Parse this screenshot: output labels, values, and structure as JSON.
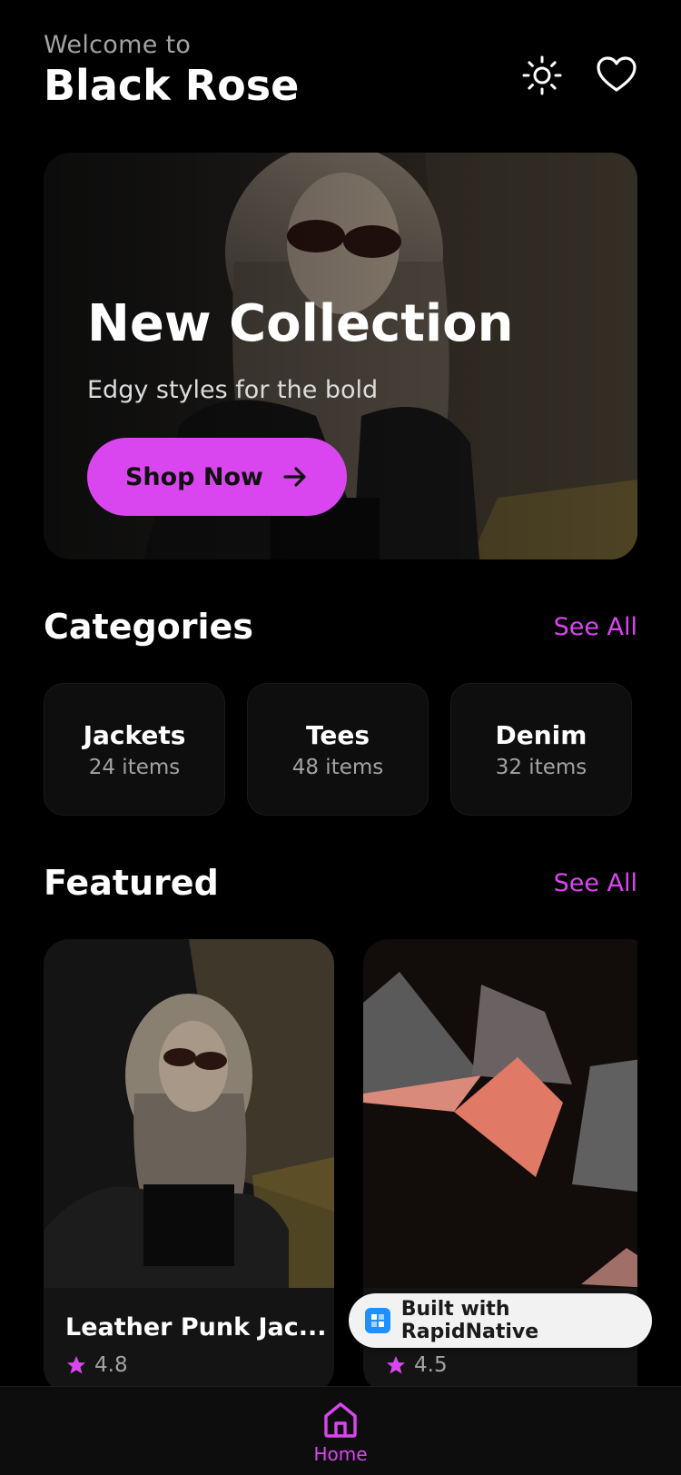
{
  "header": {
    "welcome": "Welcome to",
    "brand": "Black Rose"
  },
  "icons": {
    "theme_toggle": "sun-icon",
    "wishlist": "heart-icon"
  },
  "hero": {
    "title": "New Collection",
    "subtitle": "Edgy styles for the bold",
    "button_label": "Shop Now"
  },
  "categories": {
    "title": "Categories",
    "see_all": "See All",
    "items": [
      {
        "name": "Jackets",
        "count": "24 items"
      },
      {
        "name": "Tees",
        "count": "48 items"
      },
      {
        "name": "Denim",
        "count": "32 items"
      }
    ]
  },
  "featured": {
    "title": "Featured",
    "see_all": "See All",
    "items": [
      {
        "name": "Leather Punk Jac...",
        "rating": "4.8"
      },
      {
        "name": "",
        "rating": "4.5"
      }
    ]
  },
  "badge": {
    "label": "Built with RapidNative"
  },
  "tabbar": {
    "home_label": "Home"
  },
  "colors": {
    "accent": "#d946ef",
    "background": "#000000",
    "card": "#0e0e0e"
  }
}
